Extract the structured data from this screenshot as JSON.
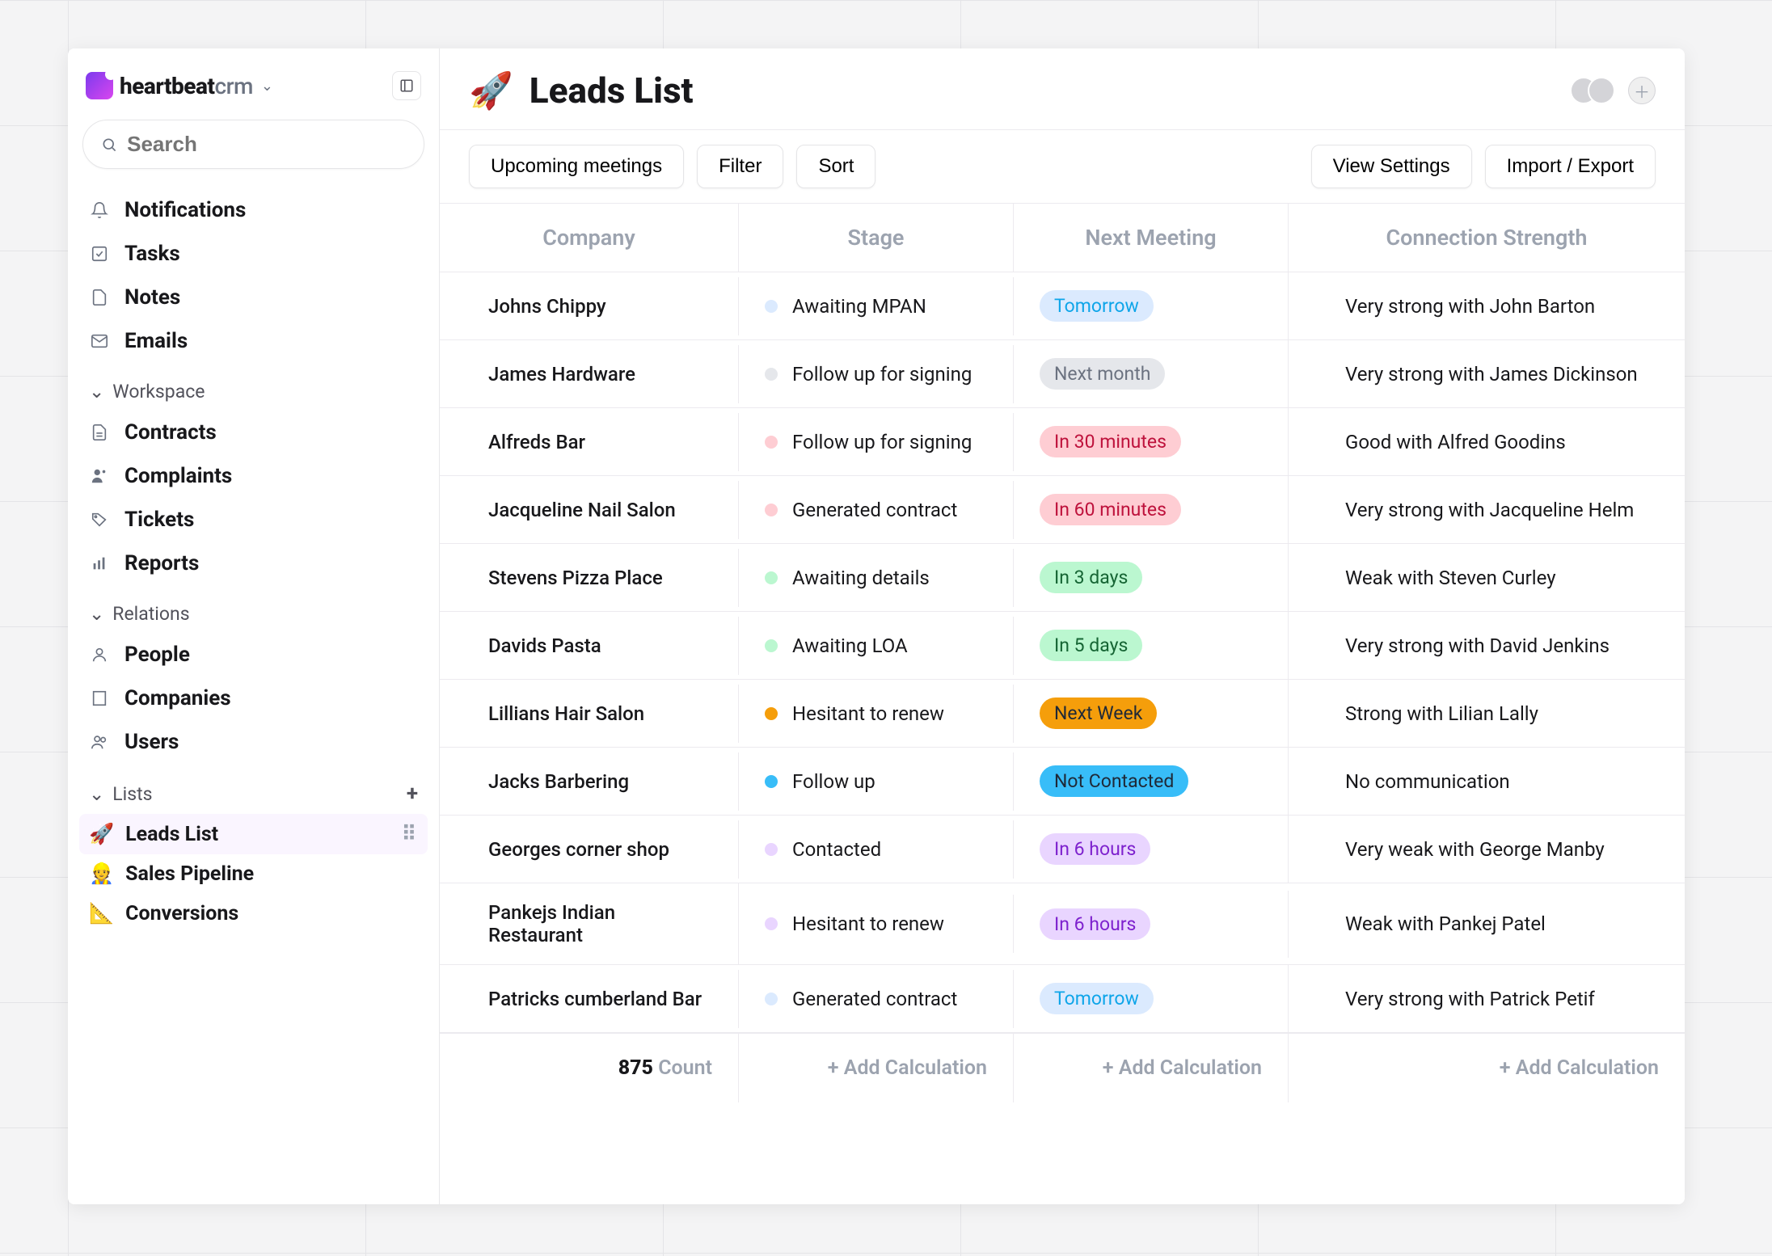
{
  "brand": {
    "name_strong": "heartbeat",
    "name_light": "crm"
  },
  "search": {
    "placeholder": "Search"
  },
  "sidebar": {
    "primary": [
      {
        "label": "Notifications",
        "icon": "bell"
      },
      {
        "label": "Tasks",
        "icon": "check"
      },
      {
        "label": "Notes",
        "icon": "doc"
      },
      {
        "label": "Emails",
        "icon": "mail"
      }
    ],
    "sections": [
      {
        "title": "Workspace",
        "items": [
          {
            "label": "Contracts",
            "icon": "file"
          },
          {
            "label": "Complaints",
            "icon": "person"
          },
          {
            "label": "Tickets",
            "icon": "tag"
          },
          {
            "label": "Reports",
            "icon": "bars"
          }
        ]
      },
      {
        "title": "Relations",
        "items": [
          {
            "label": "People",
            "icon": "user"
          },
          {
            "label": "Companies",
            "icon": "building"
          },
          {
            "label": "Users",
            "icon": "users"
          }
        ]
      },
      {
        "title": "Lists",
        "has_add": true,
        "items": [
          {
            "label": "Leads List",
            "emoji": "🚀",
            "active": true
          },
          {
            "label": "Sales Pipeline",
            "emoji": "👷"
          },
          {
            "label": "Conversions",
            "emoji": "📐"
          }
        ]
      }
    ]
  },
  "page": {
    "emoji": "🚀",
    "title": "Leads List"
  },
  "toolbar": {
    "upcoming": "Upcoming meetings",
    "filter": "Filter",
    "sort": "Sort",
    "view_settings": "View Settings",
    "import_export": "Import / Export"
  },
  "table": {
    "columns": [
      "Company",
      "Stage",
      "Next Meeting",
      "Connection Strength"
    ],
    "rows": [
      {
        "company": "Johns Chippy",
        "stage": "Awaiting MPAN",
        "stage_color": "#dbeafe",
        "meeting": "Tomorrow",
        "meeting_bg": "#dbeafe",
        "meeting_fg": "#0ea5e9",
        "conn": "Very strong with John Barton"
      },
      {
        "company": "James Hardware",
        "stage": "Follow up for signing",
        "stage_color": "#e5e7eb",
        "meeting": "Next month",
        "meeting_bg": "#e5e7eb",
        "meeting_fg": "#6b7280",
        "conn": "Very strong with James Dickinson"
      },
      {
        "company": "Alfreds Bar",
        "stage": "Follow up for signing",
        "stage_color": "#fecdd3",
        "meeting": "In 30 minutes",
        "meeting_bg": "#fecdd3",
        "meeting_fg": "#be123c",
        "conn": "Good with Alfred Goodins"
      },
      {
        "company": "Jacqueline Nail Salon",
        "stage": "Generated contract",
        "stage_color": "#fecdd3",
        "meeting": "In 60 minutes",
        "meeting_bg": "#fecdd3",
        "meeting_fg": "#be123c",
        "conn": "Very strong with Jacqueline Helm"
      },
      {
        "company": "Stevens Pizza Place",
        "stage": "Awaiting details",
        "stage_color": "#bbf7d0",
        "meeting": "In 3 days",
        "meeting_bg": "#bbf7d0",
        "meeting_fg": "#166534",
        "conn": "Weak with Steven Curley"
      },
      {
        "company": "Davids Pasta",
        "stage": "Awaiting LOA",
        "stage_color": "#bbf7d0",
        "meeting": "In 5 days",
        "meeting_bg": "#bbf7d0",
        "meeting_fg": "#166534",
        "conn": "Very strong with David Jenkins"
      },
      {
        "company": "Lillians Hair Salon",
        "stage": "Hesitant to renew",
        "stage_color": "#f59e0b",
        "meeting": "Next Week",
        "meeting_bg": "#f59e0b",
        "meeting_fg": "#1f2937",
        "conn": "Strong with Lilian Lally"
      },
      {
        "company": "Jacks Barbering",
        "stage": "Follow up",
        "stage_color": "#38bdf8",
        "meeting": "Not Contacted",
        "meeting_bg": "#38bdf8",
        "meeting_fg": "#1f2937",
        "conn": "No communication"
      },
      {
        "company": "Georges corner shop",
        "stage": "Contacted",
        "stage_color": "#e9d5ff",
        "meeting": "In 6 hours",
        "meeting_bg": "#e9d5ff",
        "meeting_fg": "#7e22ce",
        "conn": "Very weak with George Manby"
      },
      {
        "company": "Pankejs Indian Restaurant",
        "stage": "Hesitant to renew",
        "stage_color": "#e9d5ff",
        "meeting": "In 6 hours",
        "meeting_bg": "#e9d5ff",
        "meeting_fg": "#7e22ce",
        "conn": "Weak with Pankej Patel"
      },
      {
        "company": "Patricks cumberland Bar",
        "stage": "Generated contract",
        "stage_color": "#dbeafe",
        "meeting": "Tomorrow",
        "meeting_bg": "#dbeafe",
        "meeting_fg": "#0ea5e9",
        "conn": "Very strong with Patrick Petif"
      }
    ],
    "footer": {
      "count_value": "875",
      "count_label": "Count",
      "add_calc": "+ Add Calculation"
    }
  }
}
